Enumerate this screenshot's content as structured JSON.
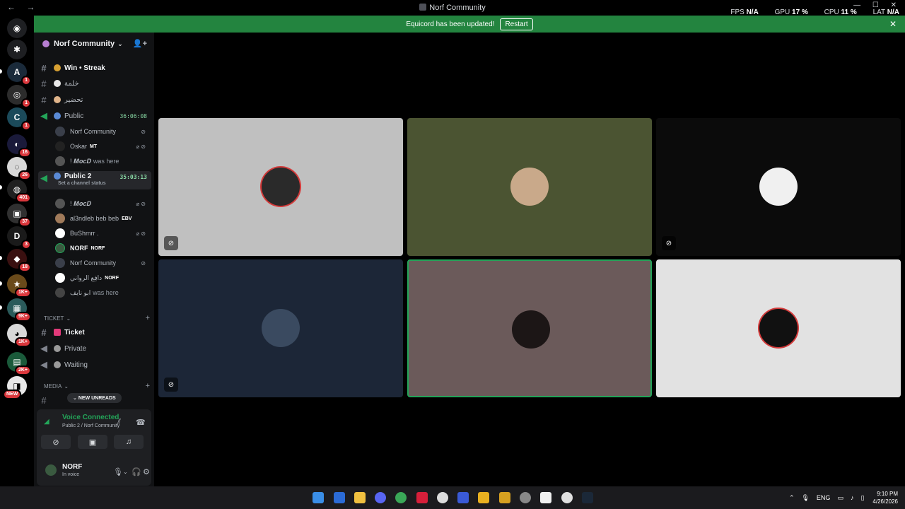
{
  "window": {
    "title": "Norf Community",
    "nav_back": "←",
    "nav_forward": "→",
    "stats": [
      {
        "label": "FPS",
        "value": "N/A"
      },
      {
        "label": "GPU",
        "value": "17 %"
      },
      {
        "label": "CPU",
        "value": "11 %"
      },
      {
        "label": "LAT",
        "value": "N/A"
      }
    ]
  },
  "banner": {
    "message": "Equicord has been updated!",
    "button": "Restart",
    "close": "✕"
  },
  "rail": {
    "badges": [
      "1",
      "1",
      "1",
      "16",
      "26",
      "401",
      "37",
      "3",
      "18",
      "1K+",
      "9K+",
      "1K+",
      "2K+",
      "NEW"
    ]
  },
  "guild": {
    "name": "Norf Community",
    "chevron": "⌄"
  },
  "channels": {
    "win_streak": "Win • Streak",
    "arabic1": "خلمة",
    "arabic2": "تحضير",
    "public": {
      "name": "Public",
      "timer": "36:06:08"
    },
    "public_users": [
      {
        "name": "Norf Community",
        "tag": ""
      },
      {
        "name": "Oskar",
        "tag": "MT"
      },
      {
        "name": "! 𝑴𝒐𝒄𝑫",
        "suffix": "was here"
      }
    ],
    "public2": {
      "name": "Public 2",
      "timer": "35:03:13",
      "status": "Set a channel status"
    },
    "public2_users": [
      {
        "name": "! 𝑴𝒐𝒄𝑫",
        "tag": ""
      },
      {
        "name": "al3ndleb beb beb",
        "tag": "EBV"
      },
      {
        "name": "BuShmrr .",
        "tag": ""
      },
      {
        "name": "NORF",
        "tag": "NORF"
      },
      {
        "name": "Norf Community",
        "tag": ""
      },
      {
        "name": "دافِع الرواني",
        "tag": "NORF"
      },
      {
        "name": "ابو نايف",
        "suffix": "was here"
      }
    ],
    "ticket_category": "TICKET",
    "ticket": "Ticket",
    "private": "Private",
    "waiting": "Waiting",
    "media_category": "MEDIA",
    "new_unreads": "NEW UNREADS"
  },
  "voice": {
    "title": "Voice Connected",
    "subtitle": "Public 2 / Norf Community"
  },
  "user": {
    "name": "NORF",
    "status": "In voice"
  },
  "tiles": [
    {
      "bg": "#c0c0c0",
      "avatar": "#2a2a2a",
      "ring": "#d33a3a"
    },
    {
      "bg": "#4b5432",
      "avatar": "#c9a98a",
      "ring": ""
    },
    {
      "bg": "#0b0b0b",
      "avatar": "#f0f0f0",
      "ring": ""
    },
    {
      "bg": "#1c2637",
      "avatar": "#3a4a60",
      "ring": ""
    },
    {
      "bg": "#6b5a5a",
      "avatar": "#1c1616",
      "ring": ""
    },
    {
      "bg": "#e2e2e2",
      "avatar": "#111111",
      "ring": "#d33a3a"
    }
  ],
  "tray": {
    "lang": "ENG",
    "time": "9:10 PM",
    "date": "4/26/2026"
  }
}
